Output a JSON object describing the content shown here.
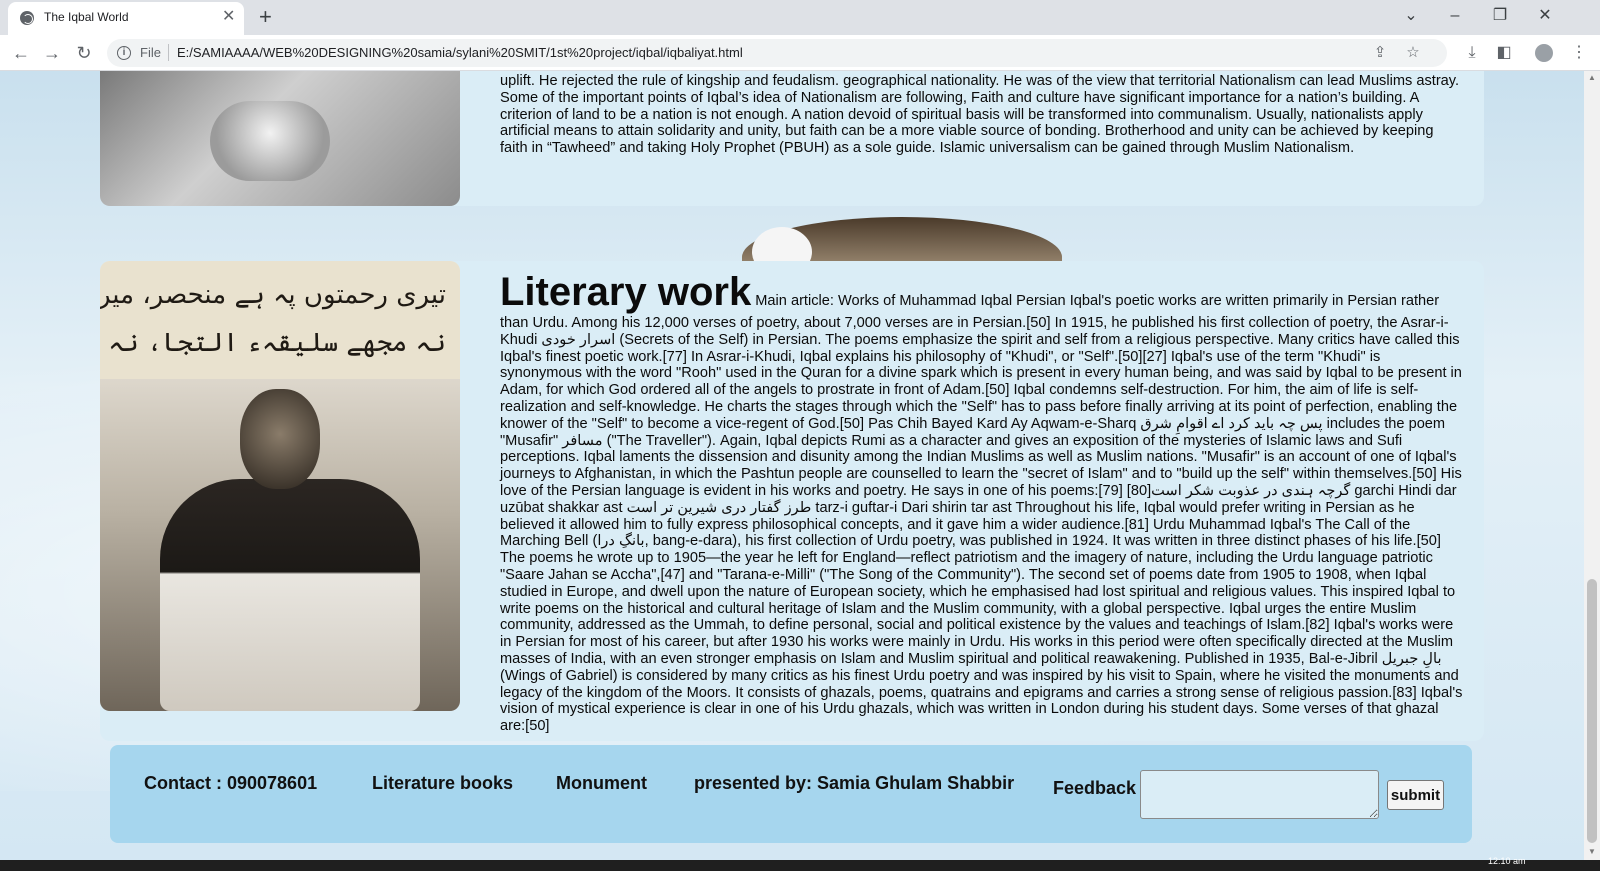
{
  "browser": {
    "tab_title": "The Iqbal World",
    "url_scheme": "File",
    "url": "E:/SAMIAAAA/WEB%20DESIGNING%20samia/sylani%20SMIT/1st%20project/iqbal/iqbaliyat.html"
  },
  "section1": {
    "paragraph": "uplift. He rejected the rule of kingship and feudalism. geographical nationality. He was of the view that territorial Nationalism can lead Muslims astray. Some of the important points of Iqbal’s idea of Nationalism are following, Faith and culture have significant importance for a nation’s building. A criterion of land to be a nation is not enough. A nation devoid of spiritual basis will be transformed into communalism. Usually, nationalists apply artificial means to attain solidarity and unity, but faith can be a more viable source of bonding. Brotherhood and unity can be achieved by keeping faith in “Tawheed” and taking Holy Prophet (PBUH) as a sole guide. Islamic universalism can be gained through Muslim Nationalism."
  },
  "section2": {
    "heading": "Literary work",
    "urdu_line_1": "تیری رحمتوں پہ ہے منحصر، میرے ہر عمل کی قبولیت",
    "urdu_line_2": "نہ مجھے سلیقہء التجا، نہ مجھے شعورِ نماز ہے",
    "paragraph": " Main article: Works of Muhammad Iqbal Persian Iqbal's poetic works are written primarily in Persian rather than Urdu. Among his 12,000 verses of poetry, about 7,000 verses are in Persian.[50] In 1915, he published his first collection of poetry, the Asrar-i-Khudi اسرار خودی (Secrets of the Self) in Persian. The poems emphasize the spirit and self from a religious perspective. Many critics have called this Iqbal's finest poetic work.[77] In Asrar-i-Khudi, Iqbal explains his philosophy of \"Khudi\", or \"Self\".[50][27] Iqbal's use of the term \"Khudi\" is synonymous with the word \"Rooh\" used in the Quran for a divine spark which is present in every human being, and was said by Iqbal to be present in Adam, for which God ordered all of the angels to prostrate in front of Adam.[50] Iqbal condemns self-destruction. For him, the aim of life is self-realization and self-knowledge. He charts the stages through which the \"Self\" has to pass before finally arriving at its point of perfection, enabling the knower of the \"Self\" to become a vice-regent of God.[50] Pas Chih Bayed Kard Ay Aqwam-e-Sharq پس چہ باید کرد اے اقوامِ شرق includes the poem \"Musafir\" مسافر (\"The Traveller\"). Again, Iqbal depicts Rumi as a character and gives an exposition of the mysteries of Islamic laws and Sufi perceptions. Iqbal laments the dissension and disunity among the Indian Muslims as well as Muslim nations. \"Musafir\" is an account of one of Iqbal's journeys to Afghanistan, in which the Pashtun people are counselled to learn the \"secret of Islam\" and to \"build up the self\" within themselves.[50] His love of the Persian language is evident in his works and poetry. He says in one of his poems:[79] [80]گرچہ ہندی در عذوبت شکر است garchi Hindi dar uzūbat shakkar ast طرز گفتار دری شیرین تر است tarz-i guftar-i Dari shirin tar ast Throughout his life, Iqbal would prefer writing in Persian as he believed it allowed him to fully express philosophical concepts, and it gave him a wider audience.[81] Urdu Muhammad Iqbal's The Call of the Marching Bell (بانگِ درا, bang-e-dara), his first collection of Urdu poetry, was published in 1924. It was written in three distinct phases of his life.[50] The poems he wrote up to 1905—the year he left for England—reflect patriotism and the imagery of nature, including the Urdu language patriotic \"Saare Jahan se Accha\",[47] and \"Tarana-e-Milli\" (\"The Song of the Community\"). The second set of poems date from 1905 to 1908, when Iqbal studied in Europe, and dwell upon the nature of European society, which he emphasised had lost spiritual and religious values. This inspired Iqbal to write poems on the historical and cultural heritage of Islam and the Muslim community, with a global perspective. Iqbal urges the entire Muslim community, addressed as the Ummah, to define personal, social and political existence by the values and teachings of Islam.[82] Iqbal's works were in Persian for most of his career, but after 1930 his works were mainly in Urdu. His works in this period were often specifically directed at the Muslim masses of India, with an even stronger emphasis on Islam and Muslim spiritual and political reawakening. Published in 1935, Bal-e-Jibril بالِ جبریل (Wings of Gabriel) is considered by many critics as his finest Urdu poetry and was inspired by his visit to Spain, where he visited the monuments and legacy of the kingdom of the Moors. It consists of ghazals, poems, quatrains and epigrams and carries a strong sense of religious passion.[83] Iqbal's vision of mystical experience is clear in one of his Urdu ghazals, which was written in London during his student days. Some verses of that ghazal are:[50]"
  },
  "footer": {
    "contact": "Contact : 090078601",
    "literature": "Literature books",
    "monument": "Monument",
    "presented": "presented by: Samia Ghulam Shabbir",
    "feedback_label": "Feedback",
    "submit": "submit"
  },
  "taskbar": {
    "clock": "12:10 am"
  },
  "colors": {
    "card": "#daedf6",
    "footer": "#a6d6ee"
  }
}
